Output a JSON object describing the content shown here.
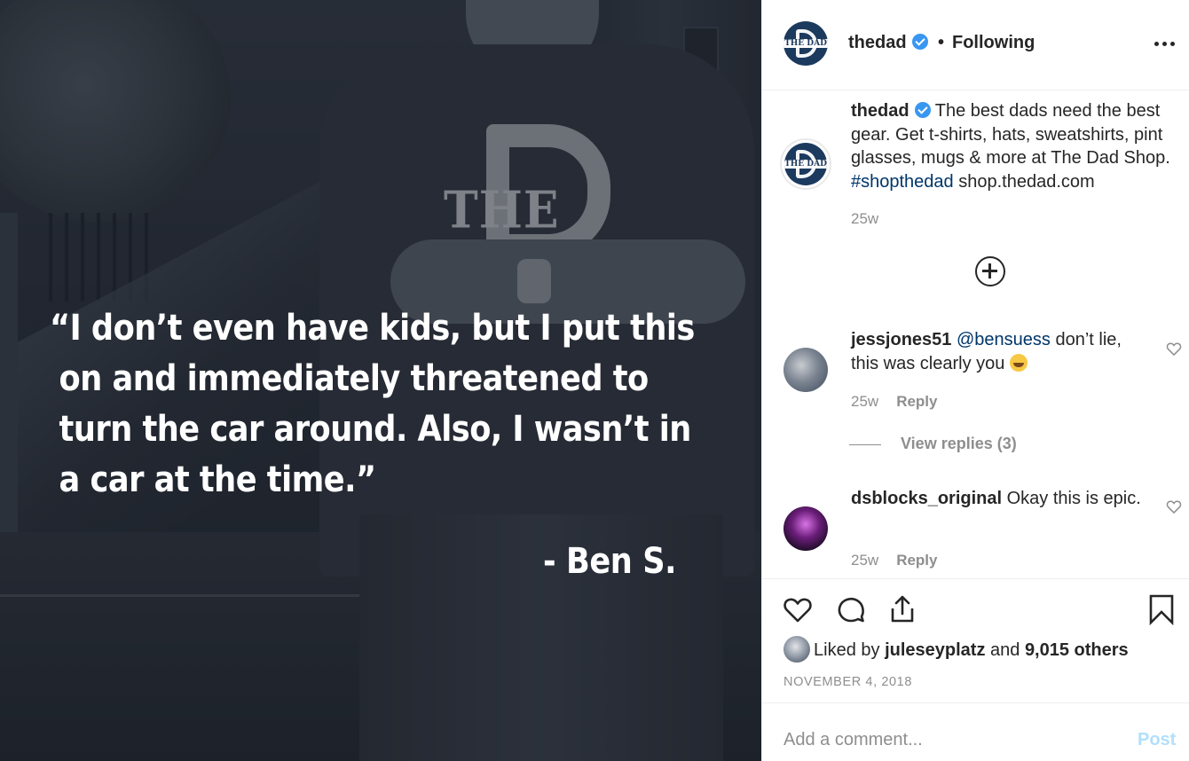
{
  "post": {
    "quote_lines": [
      "“I don’t even have kids, but I put this",
      "on and immediately threatened to",
      "turn the car around. Also, I wasn’t in",
      "a car at the time.”"
    ],
    "attribution": "- Ben S.",
    "shirt_text": "THE DAD"
  },
  "header": {
    "username": "thedad",
    "separator": "•",
    "follow_status": "Following",
    "avatar_text": "THE DAD"
  },
  "caption": {
    "username": "thedad",
    "text_before_tag": "The best dads need the best gear. Get t-shirts, hats, sweatshirts, pint glasses, mugs & more at The Dad Shop. ",
    "hashtag": "#shopthedad",
    "text_after_tag": " shop.thedad.com",
    "time": "25w",
    "avatar_text": "THE DAD"
  },
  "comments": [
    {
      "username": "jessjones51",
      "mention": "@bensuess",
      "text": " don’t lie, this was clearly you ",
      "emoji": "laughing-with-tears-emoji",
      "time": "25w",
      "reply_label": "Reply"
    },
    {
      "username": "dsblocks_original",
      "text": " Okay this is epic.",
      "time": "25w",
      "reply_label": "Reply"
    }
  ],
  "view_replies": "View replies (3)",
  "likes": {
    "prefix": "Liked by ",
    "user": "juleseyplatz",
    "middle": " and ",
    "others": "9,015 others"
  },
  "date": "NOVEMBER 4, 2018",
  "add_comment": {
    "placeholder": "Add a comment...",
    "post_label": "Post"
  },
  "colors": {
    "verified": "#3897f0",
    "link": "#003569",
    "post_disabled": "#b2dffc",
    "avatar_bg": "#1c3a5e"
  }
}
